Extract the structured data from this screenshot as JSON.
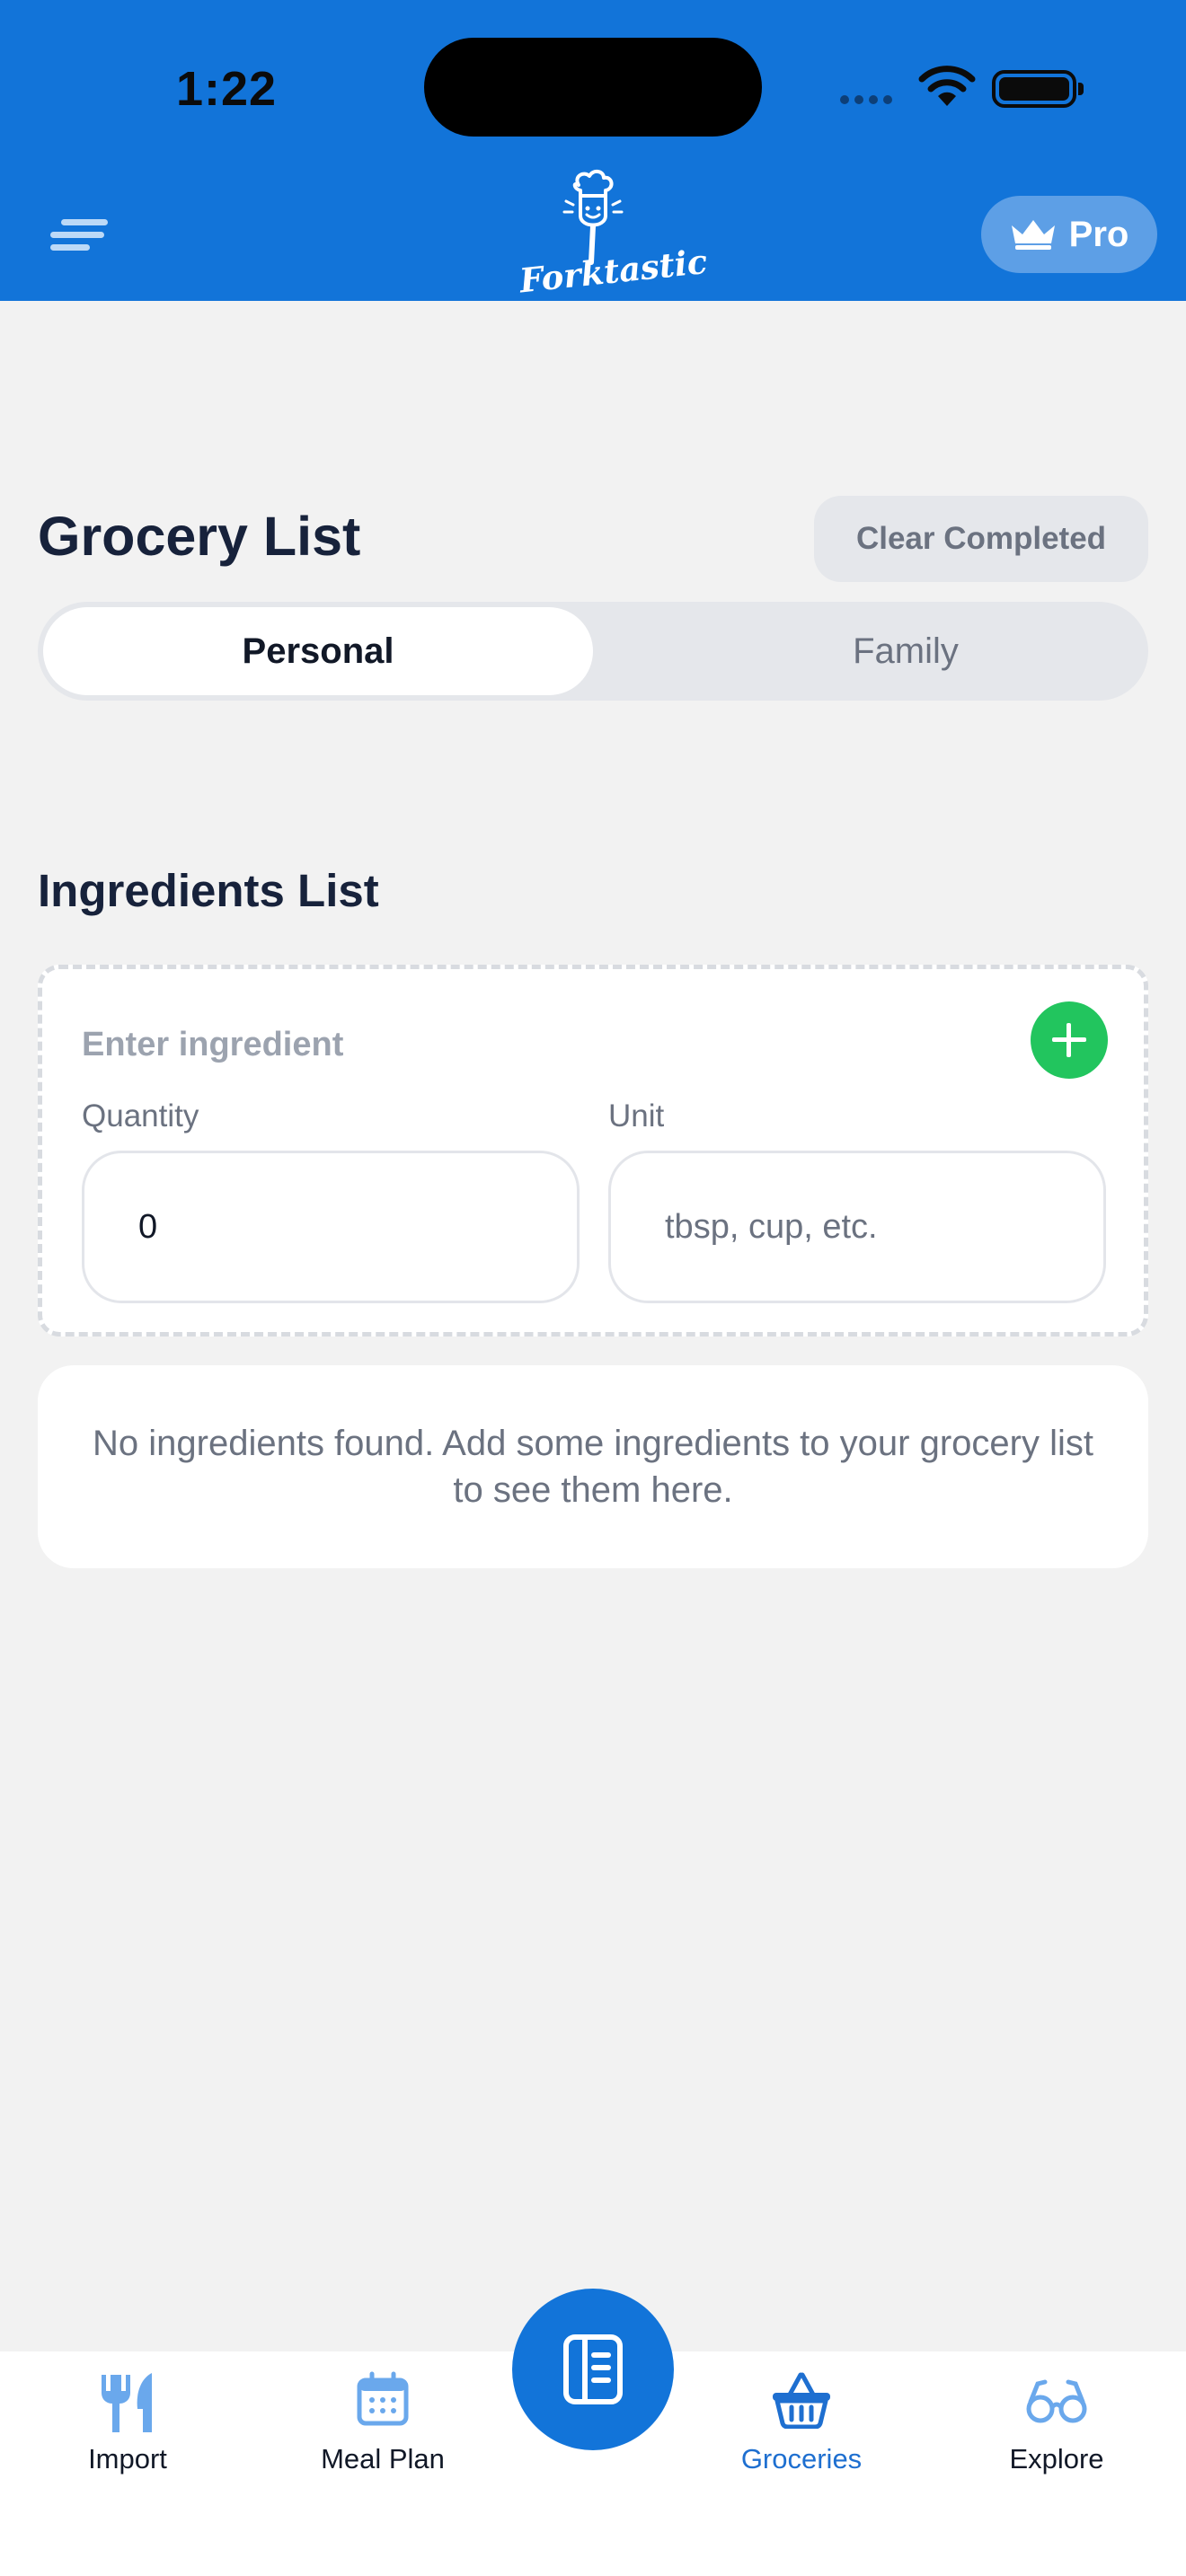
{
  "status_bar": {
    "time": "1:22"
  },
  "header": {
    "logo_text": "Forktastic",
    "pro_label": "Pro"
  },
  "page": {
    "title": "Grocery List",
    "clear_completed_label": "Clear Completed",
    "tabs": [
      {
        "label": "Personal",
        "active": true
      },
      {
        "label": "Family",
        "active": false
      }
    ]
  },
  "ingredients": {
    "section_title": "Ingredients List",
    "ingredient_placeholder": "Enter ingredient",
    "quantity_label": "Quantity",
    "quantity_value": "0",
    "unit_label": "Unit",
    "unit_placeholder": "tbsp, cup, etc.",
    "empty_message": "No ingredients found. Add some ingredients to your grocery list to see them here."
  },
  "tabbar": {
    "items": [
      {
        "label": "Import",
        "icon": "fork-knife-icon",
        "active": false
      },
      {
        "label": "Meal Plan",
        "icon": "calendar-icon",
        "active": false
      },
      {
        "label": "Groceries",
        "icon": "basket-icon",
        "active": true
      },
      {
        "label": "Explore",
        "icon": "glasses-icon",
        "active": false
      }
    ],
    "center_icon": "notebook-icon"
  },
  "colors": {
    "brand_blue": "#1274d9",
    "add_green": "#22c55e",
    "background": "#f2f2f2",
    "active_tab_label": "#1e6fd0"
  }
}
